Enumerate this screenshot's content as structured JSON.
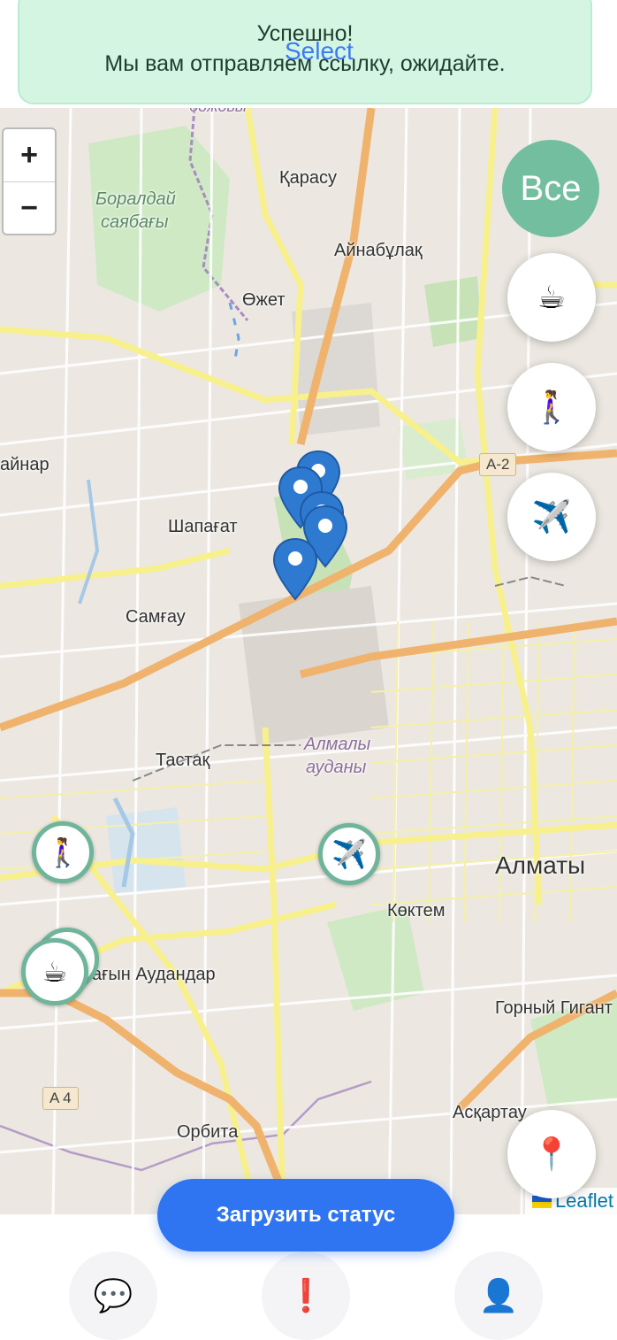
{
  "toast": {
    "title": "Успешно!",
    "message": "Мы вам отправляем ссылку, ожидайте.",
    "overlay_text": "Select"
  },
  "map": {
    "zoom_in": "+",
    "zoom_out": "−",
    "labels": {
      "borolday": "Боралдай",
      "sayabagy": "саябағы",
      "karasu": "Қарасу",
      "ainabulak": "Айнабұлақ",
      "ozhet": "Өжет",
      "ainar": "айнар",
      "shapagat": "Шапағат",
      "samgau": "Самғау",
      "tastak": "Тастақ",
      "almaly1": "Алмалы",
      "almaly2": "ауданы",
      "almaty": "Алматы",
      "koktem": "Көктем",
      "audandar": "ағын Аудандар",
      "gorny": "Горный Гигант",
      "orbita": "Орбита",
      "askartau": "Асқартау",
      "top_partial": "бөжовы"
    },
    "road_signs": {
      "a2": "A-2",
      "a4": "A 4"
    },
    "attribution": "Leaflet"
  },
  "filters": {
    "all_label": "Все",
    "coffee_icon": "☕",
    "walk_icon": "🚶‍♀️",
    "plane_icon": "✈️",
    "location_icon": "📍"
  },
  "markers": {
    "walk_icon": "🚶‍♀️",
    "plane_icon": "✈️",
    "coffee_icon": "☕"
  },
  "upload_button": "Загрузить статус",
  "nav": {
    "chat_icon": "💬",
    "alert_icon": "❗",
    "profile_icon": "👤"
  }
}
